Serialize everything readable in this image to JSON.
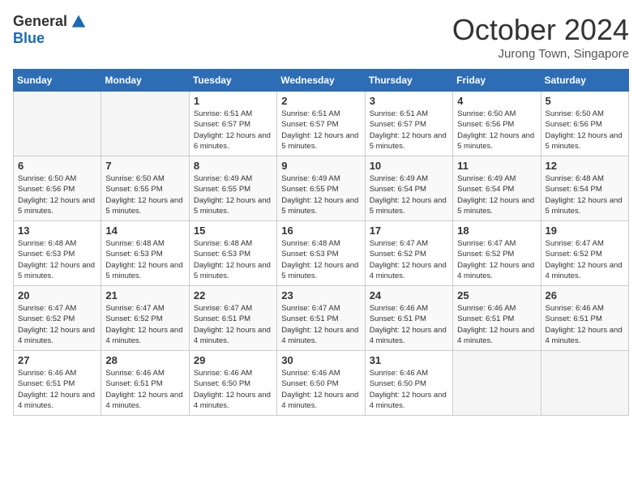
{
  "logo": {
    "general": "General",
    "blue": "Blue"
  },
  "title": "October 2024",
  "location": "Jurong Town, Singapore",
  "days_of_week": [
    "Sunday",
    "Monday",
    "Tuesday",
    "Wednesday",
    "Thursday",
    "Friday",
    "Saturday"
  ],
  "weeks": [
    [
      {
        "day": "",
        "info": ""
      },
      {
        "day": "",
        "info": ""
      },
      {
        "day": "1",
        "info": "Sunrise: 6:51 AM\nSunset: 6:57 PM\nDaylight: 12 hours and 6 minutes."
      },
      {
        "day": "2",
        "info": "Sunrise: 6:51 AM\nSunset: 6:57 PM\nDaylight: 12 hours and 5 minutes."
      },
      {
        "day": "3",
        "info": "Sunrise: 6:51 AM\nSunset: 6:57 PM\nDaylight: 12 hours and 5 minutes."
      },
      {
        "day": "4",
        "info": "Sunrise: 6:50 AM\nSunset: 6:56 PM\nDaylight: 12 hours and 5 minutes."
      },
      {
        "day": "5",
        "info": "Sunrise: 6:50 AM\nSunset: 6:56 PM\nDaylight: 12 hours and 5 minutes."
      }
    ],
    [
      {
        "day": "6",
        "info": "Sunrise: 6:50 AM\nSunset: 6:56 PM\nDaylight: 12 hours and 5 minutes."
      },
      {
        "day": "7",
        "info": "Sunrise: 6:50 AM\nSunset: 6:55 PM\nDaylight: 12 hours and 5 minutes."
      },
      {
        "day": "8",
        "info": "Sunrise: 6:49 AM\nSunset: 6:55 PM\nDaylight: 12 hours and 5 minutes."
      },
      {
        "day": "9",
        "info": "Sunrise: 6:49 AM\nSunset: 6:55 PM\nDaylight: 12 hours and 5 minutes."
      },
      {
        "day": "10",
        "info": "Sunrise: 6:49 AM\nSunset: 6:54 PM\nDaylight: 12 hours and 5 minutes."
      },
      {
        "day": "11",
        "info": "Sunrise: 6:49 AM\nSunset: 6:54 PM\nDaylight: 12 hours and 5 minutes."
      },
      {
        "day": "12",
        "info": "Sunrise: 6:48 AM\nSunset: 6:54 PM\nDaylight: 12 hours and 5 minutes."
      }
    ],
    [
      {
        "day": "13",
        "info": "Sunrise: 6:48 AM\nSunset: 6:53 PM\nDaylight: 12 hours and 5 minutes."
      },
      {
        "day": "14",
        "info": "Sunrise: 6:48 AM\nSunset: 6:53 PM\nDaylight: 12 hours and 5 minutes."
      },
      {
        "day": "15",
        "info": "Sunrise: 6:48 AM\nSunset: 6:53 PM\nDaylight: 12 hours and 5 minutes."
      },
      {
        "day": "16",
        "info": "Sunrise: 6:48 AM\nSunset: 6:53 PM\nDaylight: 12 hours and 5 minutes."
      },
      {
        "day": "17",
        "info": "Sunrise: 6:47 AM\nSunset: 6:52 PM\nDaylight: 12 hours and 4 minutes."
      },
      {
        "day": "18",
        "info": "Sunrise: 6:47 AM\nSunset: 6:52 PM\nDaylight: 12 hours and 4 minutes."
      },
      {
        "day": "19",
        "info": "Sunrise: 6:47 AM\nSunset: 6:52 PM\nDaylight: 12 hours and 4 minutes."
      }
    ],
    [
      {
        "day": "20",
        "info": "Sunrise: 6:47 AM\nSunset: 6:52 PM\nDaylight: 12 hours and 4 minutes."
      },
      {
        "day": "21",
        "info": "Sunrise: 6:47 AM\nSunset: 6:52 PM\nDaylight: 12 hours and 4 minutes."
      },
      {
        "day": "22",
        "info": "Sunrise: 6:47 AM\nSunset: 6:51 PM\nDaylight: 12 hours and 4 minutes."
      },
      {
        "day": "23",
        "info": "Sunrise: 6:47 AM\nSunset: 6:51 PM\nDaylight: 12 hours and 4 minutes."
      },
      {
        "day": "24",
        "info": "Sunrise: 6:46 AM\nSunset: 6:51 PM\nDaylight: 12 hours and 4 minutes."
      },
      {
        "day": "25",
        "info": "Sunrise: 6:46 AM\nSunset: 6:51 PM\nDaylight: 12 hours and 4 minutes."
      },
      {
        "day": "26",
        "info": "Sunrise: 6:46 AM\nSunset: 6:51 PM\nDaylight: 12 hours and 4 minutes."
      }
    ],
    [
      {
        "day": "27",
        "info": "Sunrise: 6:46 AM\nSunset: 6:51 PM\nDaylight: 12 hours and 4 minutes."
      },
      {
        "day": "28",
        "info": "Sunrise: 6:46 AM\nSunset: 6:51 PM\nDaylight: 12 hours and 4 minutes."
      },
      {
        "day": "29",
        "info": "Sunrise: 6:46 AM\nSunset: 6:50 PM\nDaylight: 12 hours and 4 minutes."
      },
      {
        "day": "30",
        "info": "Sunrise: 6:46 AM\nSunset: 6:50 PM\nDaylight: 12 hours and 4 minutes."
      },
      {
        "day": "31",
        "info": "Sunrise: 6:46 AM\nSunset: 6:50 PM\nDaylight: 12 hours and 4 minutes."
      },
      {
        "day": "",
        "info": ""
      },
      {
        "day": "",
        "info": ""
      }
    ]
  ]
}
